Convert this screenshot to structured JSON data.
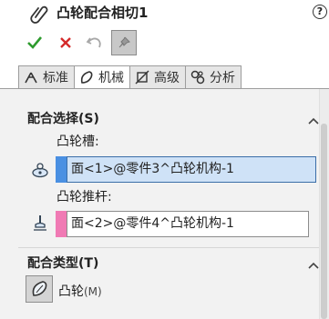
{
  "header": {
    "title": "凸轮配合相切1",
    "help_glyph": "?"
  },
  "commands": {
    "ok": "ok-check-icon",
    "cancel": "cancel-x-icon",
    "undo": "undo-icon",
    "pin": "pin-icon"
  },
  "tabs": [
    {
      "label": "标准",
      "icon": "standard-mates-icon",
      "active": false
    },
    {
      "label": "机械",
      "icon": "mechanical-mates-icon",
      "active": true
    },
    {
      "label": "高级",
      "icon": "advanced-mates-icon",
      "active": false
    },
    {
      "label": "分析",
      "icon": "analysis-icon",
      "active": false
    }
  ],
  "mate_selections": {
    "title": "配合选择(S)",
    "cam_slot_label": "凸轮槽:",
    "cam_slot_value": "面<1>@零件3^凸轮机构-1",
    "cam_slot_color": "#4a90e2",
    "follower_label": "凸轮推杆:",
    "follower_value": "面<2>@零件4^凸轮机构-1",
    "follower_color": "#f07ab4"
  },
  "mate_type": {
    "title": "配合类型(T)",
    "option_label": "凸轮",
    "option_shortcut": "(M)"
  },
  "colors": {
    "panel_bg": "#f2f2f2",
    "active_field": "#cfe2f7",
    "ok_green": "#2e9b2e",
    "cancel_red": "#d42a2a"
  }
}
